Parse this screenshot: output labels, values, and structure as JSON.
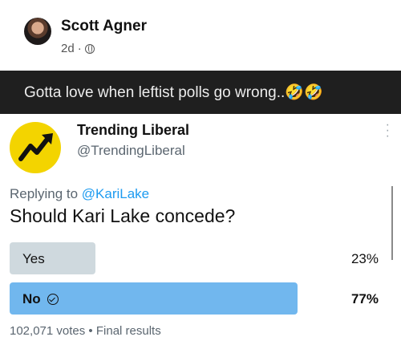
{
  "post": {
    "author": "Scott Agner",
    "age": "2d",
    "dot": "·",
    "caption": "Gotta love when leftist polls go wrong..🤣🤣"
  },
  "tweet": {
    "name": "Trending Liberal",
    "handle": "@TrendingLiberal",
    "replying_prefix": "Replying to ",
    "replying_to": "@KariLake",
    "question": "Should Kari Lake concede?",
    "options": [
      {
        "label": "Yes",
        "percent": "23%",
        "fraction": 0.23,
        "selected": false
      },
      {
        "label": "No",
        "percent": "77%",
        "fraction": 0.77,
        "selected": true
      }
    ],
    "votes": "102,071 votes",
    "separator": "•",
    "status": "Final results"
  },
  "colors": {
    "poll_fill": "#cfd9de",
    "poll_winner": "#71b7ee",
    "caption_bg": "#1f1f1f",
    "logo_bg": "#f3d400"
  },
  "icons": [
    "globe-icon",
    "trending-arrow-icon",
    "more-options-icon",
    "checkmark-circle-icon"
  ]
}
